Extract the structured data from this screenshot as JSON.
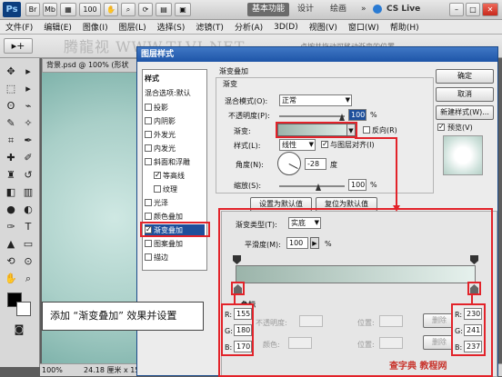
{
  "ps": {
    "logo": "Ps",
    "workspaces": [
      "基本功能",
      "设计",
      "绘画"
    ],
    "more": "»",
    "cs_live": "CS Live",
    "menu": [
      "文件(F)",
      "编辑(E)",
      "图像(I)",
      "图层(L)",
      "选择(S)",
      "滤镜(T)",
      "分析(A)",
      "3D(D)",
      "视图(V)",
      "窗口(W)",
      "帮助(H)"
    ],
    "watermark": "腾龍视 WWW.TLVI.NET",
    "doc_tab": "背景.psd @ 100% (形状",
    "status_zoom": "100%",
    "status_size": "24.18 厘米 x 15.24 厘米 (72 ppi)",
    "hint_text": "点按并拖动可移动渐变的位置。"
  },
  "dialog": {
    "title": "图层样式",
    "style_items": [
      {
        "label": "样式",
        "type": "head"
      },
      {
        "label": "混合选项:默认",
        "type": "head"
      },
      {
        "label": "投影",
        "checked": false
      },
      {
        "label": "内阴影",
        "checked": false
      },
      {
        "label": "外发光",
        "checked": false
      },
      {
        "label": "内发光",
        "checked": false
      },
      {
        "label": "斜面和浮雕",
        "checked": false
      },
      {
        "label": "等高线",
        "checked": true,
        "indent": true
      },
      {
        "label": "纹理",
        "checked": false,
        "indent": true
      },
      {
        "label": "光泽",
        "checked": false
      },
      {
        "label": "颜色叠加",
        "checked": false
      },
      {
        "label": "渐变叠加",
        "checked": true,
        "selected": true
      },
      {
        "label": "图案叠加",
        "checked": false
      },
      {
        "label": "描边",
        "checked": false
      }
    ],
    "section_title": "渐变叠加",
    "subsection_title": "渐变",
    "blend_mode_label": "混合模式(O):",
    "blend_mode_value": "正常",
    "opacity_label": "不透明度(P):",
    "opacity_value": "100",
    "percent": "%",
    "gradient_label": "渐变:",
    "reverse_label": "反向(R)",
    "style_label": "样式(L):",
    "style_value": "线性",
    "align_label": "与图层对齐(I)",
    "angle_label": "角度(N):",
    "angle_value": "-28",
    "degree": "度",
    "scale_label": "缩放(S):",
    "scale_value": "100",
    "set_default": "设置为默认值",
    "reset_default": "复位为默认值",
    "ok": "确定",
    "cancel": "取消",
    "new_style": "新建样式(W)...",
    "preview": "预览(V)"
  },
  "editor": {
    "gradient_type_label": "渐变类型(T):",
    "gradient_type_value": "实底",
    "smoothness_label": "平滑度(M):",
    "smoothness_value": "100",
    "color_section": "色标",
    "opacity_label": "不透明度:",
    "position_label": "位置:",
    "color_label": "颜色:",
    "delete_label": "删除",
    "left_stop": {
      "R": "155",
      "G": "180",
      "B": "170"
    },
    "right_stop": {
      "R": "230",
      "G": "241",
      "B": "237"
    },
    "r": "R:",
    "g": "G:",
    "b": "B:"
  },
  "callout": "添加 “渐变叠加” 效果并设置",
  "site_watermark": "查字典 教程网",
  "colors": {
    "accent_red": "#e2232a",
    "title_blue": "#1e55a7",
    "gradient_start": "#9bb4aa",
    "gradient_end": "#e6f1ed"
  }
}
